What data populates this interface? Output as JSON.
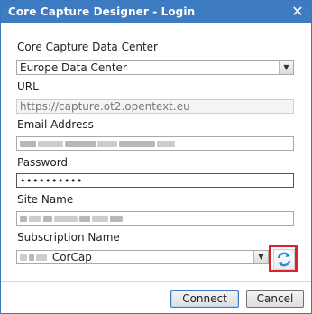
{
  "window": {
    "title": "Core Capture Designer - Login",
    "close_glyph": "✕"
  },
  "data_center": {
    "label": "Core Capture Data Center",
    "selected": "Europe Data Center"
  },
  "url": {
    "label": "URL",
    "value": "https://capture.ot2.opentext.eu"
  },
  "email": {
    "label": "Email Address"
  },
  "password": {
    "label": "Password",
    "value": "••••••••••"
  },
  "site": {
    "label": "Site Name"
  },
  "subscription": {
    "label": "Subscription Name",
    "visible_value": "CorCap"
  },
  "icons": {
    "refresh": "refresh-icon",
    "close": "close-icon",
    "dropdown": "chevron-down-icon"
  },
  "colors": {
    "titlebar": "#3d7cc2",
    "highlight": "#d9242c",
    "refresh_blue": "#2b87d8"
  },
  "buttons": {
    "connect": "Connect",
    "cancel": "Cancel"
  }
}
